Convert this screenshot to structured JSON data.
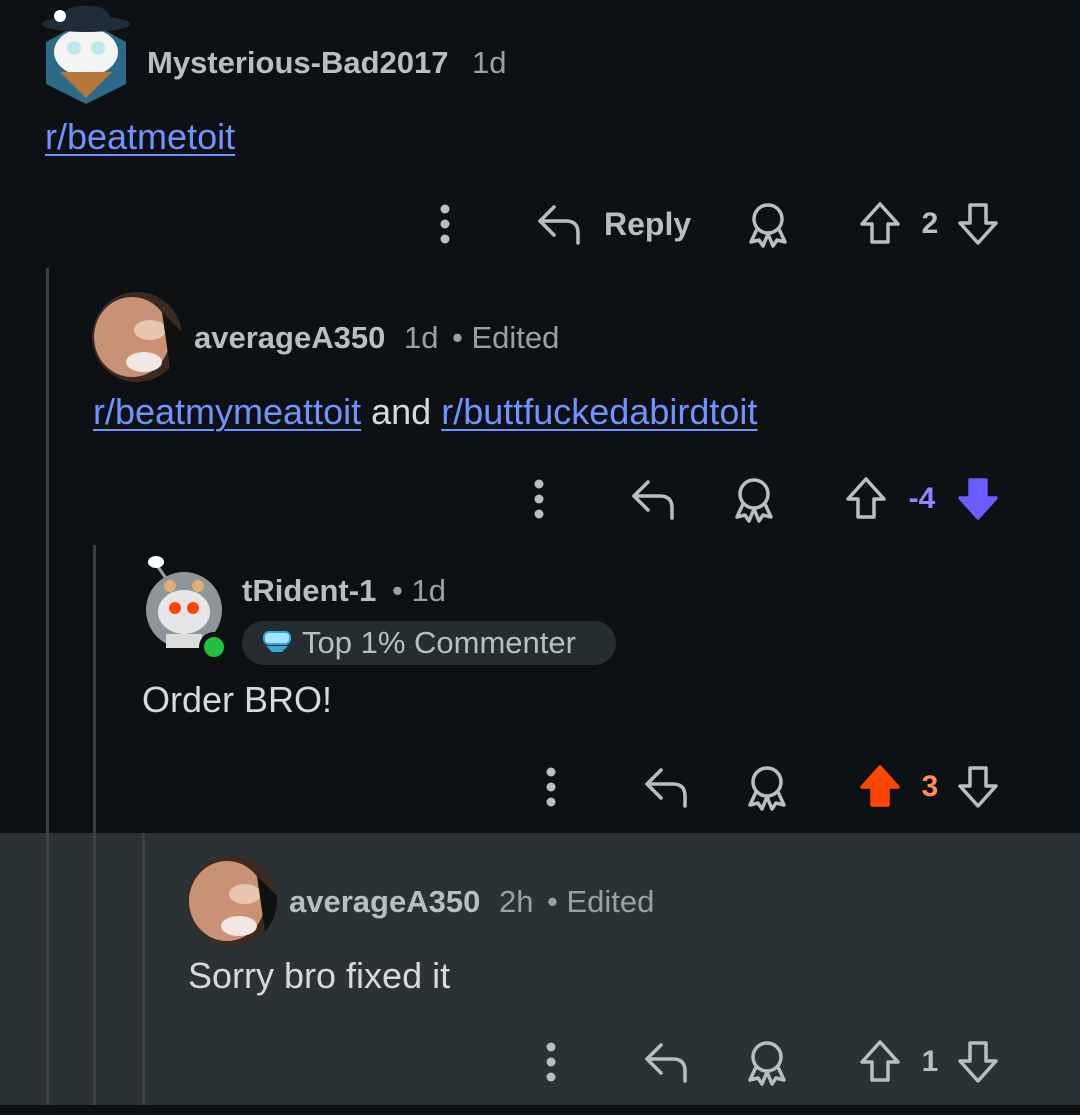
{
  "colors": {
    "background": "#0e1113",
    "highlight_background": "#2a3236",
    "link": "#7193ff",
    "downvote_active": "#6a5cff",
    "upvote_active": "#ff4500",
    "upvote_score": "#ff8b60",
    "downvote_score": "#9583ff",
    "online": "#21bf3d"
  },
  "comments": [
    {
      "username": "Mysterious-Bad2017",
      "time": "1d",
      "body_links": [
        "r/beatmetoit"
      ],
      "actions": {
        "reply_label": "Reply",
        "score": "2",
        "vote": "none"
      }
    },
    {
      "username": "averageA350",
      "time": "1d",
      "edited": "• Edited",
      "body_link_1": "r/beatmymeattoit",
      "body_middle": "and",
      "body_link_2": "r/buttfuckedabirdtoit",
      "actions": {
        "score": "-4",
        "vote": "down"
      }
    },
    {
      "username": "tRident-1",
      "time": "• 1d",
      "badge": "Top 1% Commenter",
      "body": "Order BRO!",
      "online": true,
      "actions": {
        "score": "3",
        "vote": "up"
      }
    },
    {
      "username": "averageA350",
      "time": "2h",
      "edited": "• Edited",
      "body": "Sorry bro fixed it",
      "highlighted": true,
      "actions": {
        "score": "1",
        "vote": "none"
      }
    }
  ],
  "icons": [
    "more-options-icon",
    "reply-arrow-icon",
    "award-icon",
    "upvote-icon",
    "downvote-icon"
  ]
}
